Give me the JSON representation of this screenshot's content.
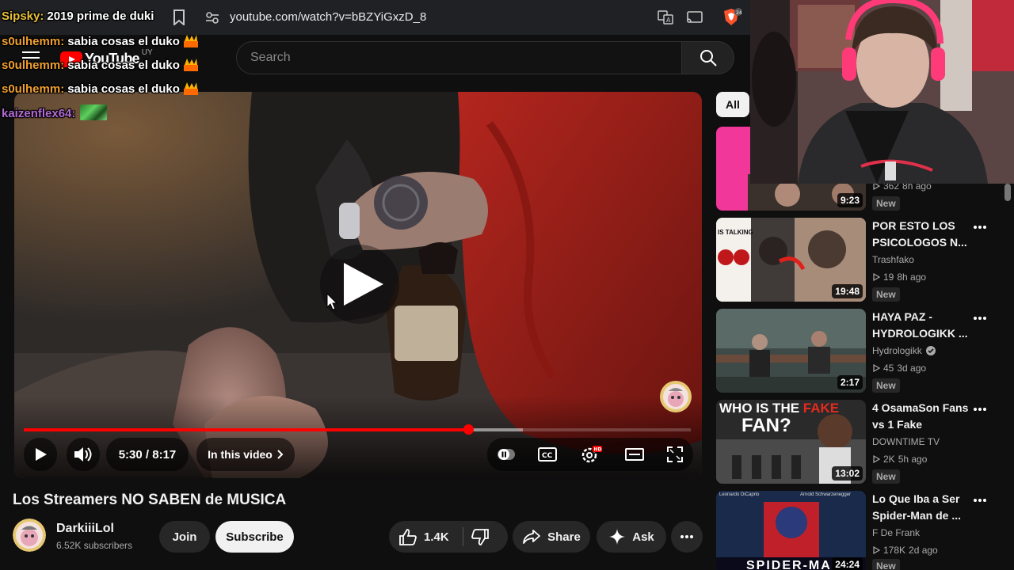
{
  "browser": {
    "url": "youtube.com/watch?v=bBZYiGxzD_8"
  },
  "masthead": {
    "logo_text": "YouTube",
    "country": "UY",
    "search_placeholder": "Search"
  },
  "chat": [
    {
      "user": "Sipsky:",
      "user_color": "#e8c03a",
      "message": "2019 prime de duki",
      "emote": ""
    },
    {
      "user": "s0ulhemm:",
      "user_color": "#f0a030",
      "message": "sabia cosas el duko",
      "emote": "fire"
    },
    {
      "user": "s0ulhemm:",
      "user_color": "#f0a030",
      "message": "sabia cosas el duko",
      "emote": "fire"
    },
    {
      "user": "s0ulhemm:",
      "user_color": "#f0a030",
      "message": "sabia cosas el duko",
      "emote": "fire"
    },
    {
      "user": "kaizenflex64:",
      "user_color": "#b36bd6",
      "message": "",
      "emote": "green-emote"
    }
  ],
  "player": {
    "current_time": "5:30",
    "duration": "8:17",
    "time_display": "5:30 / 8:17",
    "played_fraction": 0.666,
    "buffered_fraction": 0.748,
    "chapters_label": "In this video",
    "progress_color": "#ff0000"
  },
  "video": {
    "title": "Los Streamers NO SABEN de MUSICA",
    "channel": "DarkiiiLol",
    "subscribers": "6.52K subscribers",
    "join_label": "Join",
    "subscribe_label": "Subscribe",
    "likes": "1.4K",
    "share_label": "Share",
    "ask_label": "Ask"
  },
  "sidebar": {
    "chip_all": "All",
    "recommendations": [
      {
        "title": "",
        "channel": "",
        "views": "362",
        "age": "8h ago",
        "badge": "New",
        "duration": "9:23"
      },
      {
        "title": "POR ESTO LOS PSICOLOGOS N...",
        "channel": "Trashfako",
        "verified": false,
        "views": "19",
        "age": "8h ago",
        "badge": "New",
        "duration": "19:48"
      },
      {
        "title": "HAYA PAZ - HYDROLOGIKK ...",
        "channel": "Hydrologikk",
        "verified": true,
        "views": "45",
        "age": "3d ago",
        "badge": "New",
        "duration": "2:17"
      },
      {
        "title": "4 OsamaSon Fans vs 1 Fake",
        "channel": "DOWNTIME TV",
        "verified": false,
        "views": "2K",
        "age": "5h ago",
        "badge": "New",
        "duration": "13:02"
      },
      {
        "title": "Lo Que Iba a Ser Spider-Man de ...",
        "channel": "F De Frank",
        "verified": false,
        "views": "178K",
        "age": "2d ago",
        "badge": "New",
        "duration": "24:24"
      }
    ]
  },
  "thumb_texts": {
    "t2_caption": "IS TALKING",
    "t4_caption_a": "WHO IS THE",
    "t4_caption_b": "FAKE",
    "t4_caption_c": "FAN?",
    "t5_caption_a": "Leonardo DiCaprio",
    "t5_caption_b": "Arnold Schwarzenegger",
    "t5_caption_c": "SPIDER-MA"
  }
}
